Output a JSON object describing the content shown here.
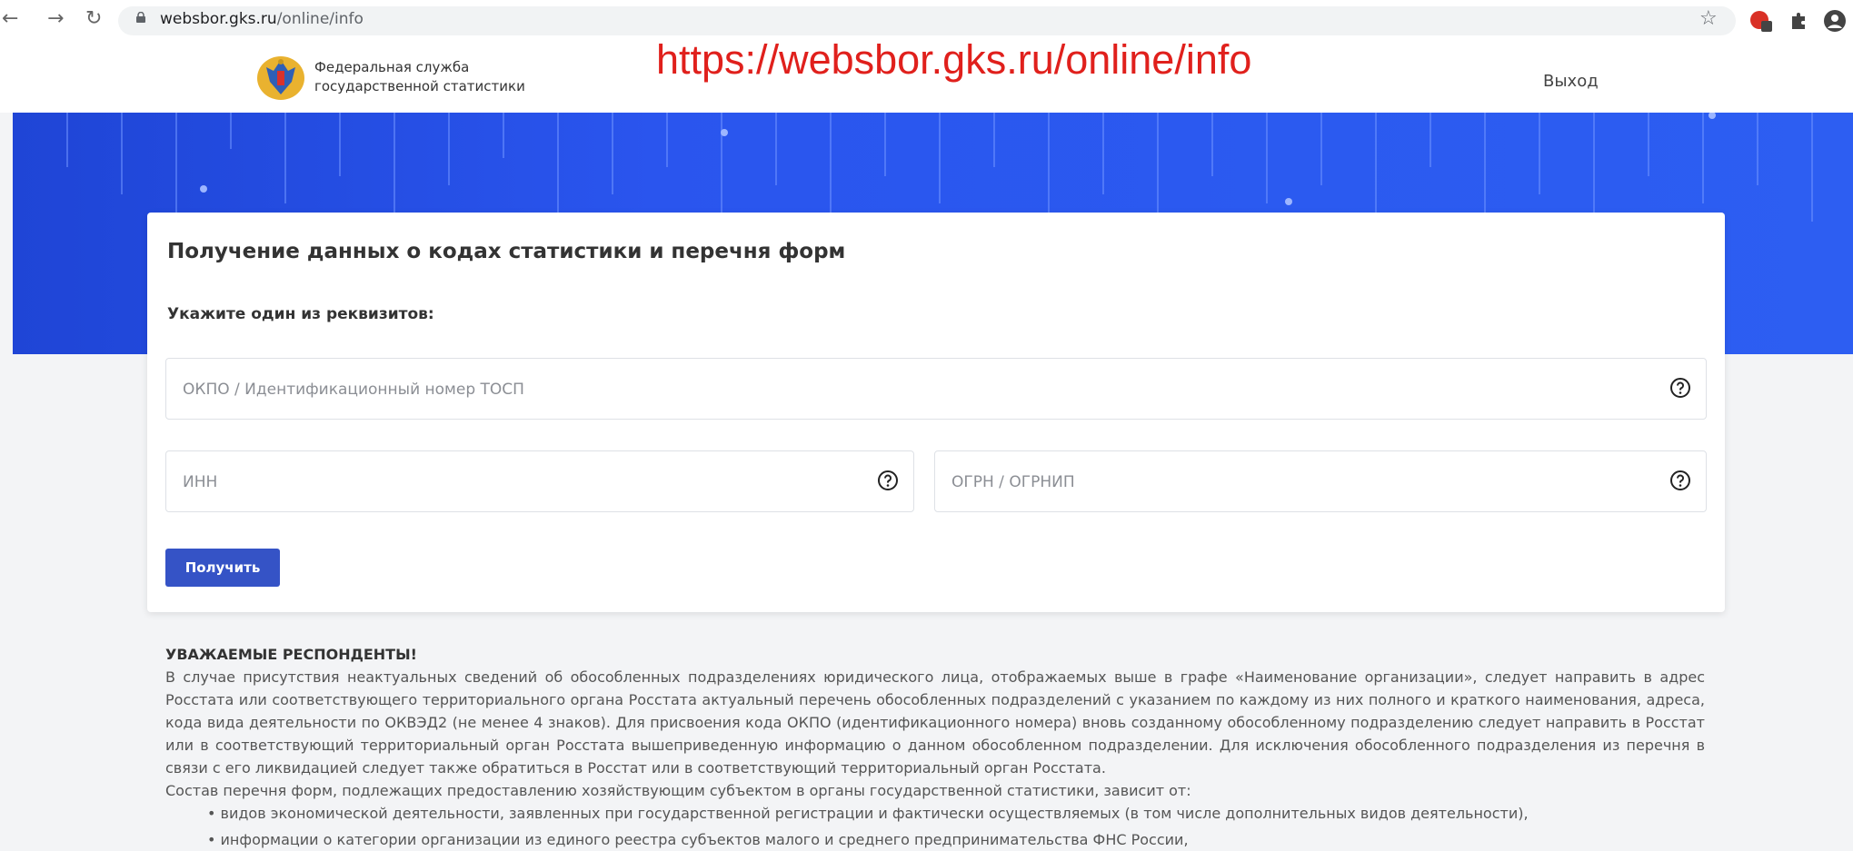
{
  "browser": {
    "url_host": "websbor.gks.ru",
    "url_path": "/online/info",
    "icons": [
      "back-icon",
      "forward-icon",
      "reload-icon",
      "lock-icon",
      "bookmark-star-icon",
      "extension-badge-icon",
      "extensions-puzzle-icon",
      "profile-icon"
    ]
  },
  "header": {
    "org_line1": "Федеральная служба",
    "org_line2": "государственной статистики",
    "logout": "Выход"
  },
  "overlay_url": "https://websbor.gks.ru/online/info",
  "card": {
    "title": "Получение данных о кодах статистики и перечня форм",
    "subtitle": "Укажите один из реквизитов:",
    "okpo_placeholder": "ОКПО / Идентификационный номер ТОСП",
    "inn_placeholder": "ИНН",
    "ogrn_placeholder": "ОГРН / ОГРНИП",
    "submit": "Получить"
  },
  "notice": {
    "title": "УВАЖАЕМЫЕ РЕСПОНДЕНТЫ!",
    "paragraph": "В случае присутствия неактуальных сведений об обособленных подразделениях юридического лица, отображаемых выше в графе «Наименование организации», следует направить в адрес Росстата или соответствующего территориального органа Росстата актуальный перечень обособленных подразделений с указанием по каждому из них полного и краткого наименования, адреса, кода вида деятельности по ОКВЭД2 (не менее 4 знаков). Для присвоения кода ОКПО (идентификационного номера) вновь созданному обособленному подразделению следует направить в Росстат или в соответствующий территориальный орган Росстата вышеприведенную информацию о данном обособленном подразделении. Для исключения обособленного подразделения из перечня в связи с его ликвидацией следует также обратиться в Росстат или в соответствующий территориальный орган Росстата.",
    "list_intro": "Состав перечня форм, подлежащих предоставлению хозяйствующим субъектом в органы государственной статистики, зависит от:",
    "items": [
      "видов экономической деятельности, заявленных при государственной регистрации и фактически осуществляемых (в том числе дополнительных видов деятельности),",
      "информации о категории организации из единого реестра субъектов малого и среднего предпринимательства ФНС России,"
    ]
  },
  "colors": {
    "banner": "#2a55ee",
    "button": "#3553c6",
    "overlay_text": "#e0201c"
  }
}
